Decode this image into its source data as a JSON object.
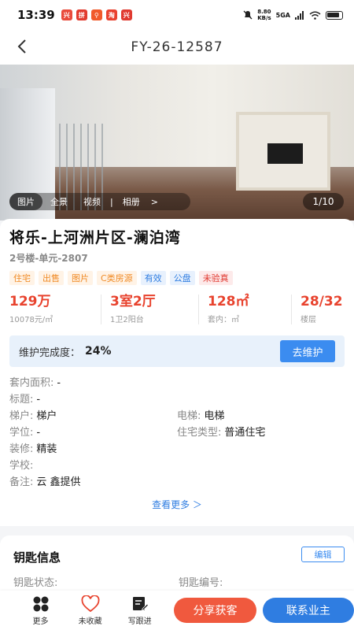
{
  "status_bar": {
    "time": "13:39",
    "net_speed_value": "8.80",
    "net_speed_unit": "KB/s",
    "network": "5GA"
  },
  "header": {
    "title": "FY-26-12587"
  },
  "gallery": {
    "tabs": [
      "图片",
      "全景",
      "视频",
      "|",
      "相册",
      ">"
    ],
    "counter": "1/10"
  },
  "listing": {
    "title": "将乐-上河洲片区-澜泊湾",
    "subtitle": "2号楼-单元-2807",
    "tags": [
      {
        "label": "住宅",
        "color": "orange"
      },
      {
        "label": "出售",
        "color": "orange"
      },
      {
        "label": "图片",
        "color": "orange"
      },
      {
        "label": "C类房源",
        "color": "orange"
      },
      {
        "label": "有效",
        "color": "blue"
      },
      {
        "label": "公盘",
        "color": "blue"
      },
      {
        "label": "未验真",
        "color": "red"
      }
    ],
    "stats": [
      {
        "value": "129万",
        "label": "10078元/㎡"
      },
      {
        "value": "3室2厅",
        "label": "1卫2阳台"
      },
      {
        "value": "128㎡",
        "label": "套内：㎡"
      },
      {
        "value": "28/32",
        "label": "楼层"
      }
    ]
  },
  "maintenance": {
    "label": "维护完成度：",
    "value": "24%",
    "percent": 24,
    "button": "去维护"
  },
  "info": {
    "inner_area_key": "套内面积:",
    "inner_area_val": "-",
    "title_key": "标题:",
    "title_val": "-",
    "stair_key": "梯户:",
    "stair_val": "梯户",
    "elevator_key": "电梯:",
    "elevator_val": "电梯",
    "school_district_key": "学位:",
    "school_district_val": "-",
    "house_type_key": "住宅类型:",
    "house_type_val": "普通住宅",
    "decoration_key": "装修:",
    "decoration_val": "精装",
    "school_key": "学校:",
    "school_val": "",
    "remark_key": "备注:",
    "remark_val": "云 鑫提供"
  },
  "more_link": "查看更多 ＞",
  "keys": {
    "title": "钥匙信息",
    "edit": "编辑",
    "status_key": "钥匙状态:",
    "number_key": "钥匙编号:"
  },
  "bottom_bar": {
    "more": "更多",
    "favorite": "未收藏",
    "follow": "写跟进",
    "share": "分享获客",
    "contact": "联系业主"
  },
  "colors": {
    "accent_red": "#e8432e",
    "primary_blue": "#2f7de1",
    "share_orange": "#f0593e"
  }
}
